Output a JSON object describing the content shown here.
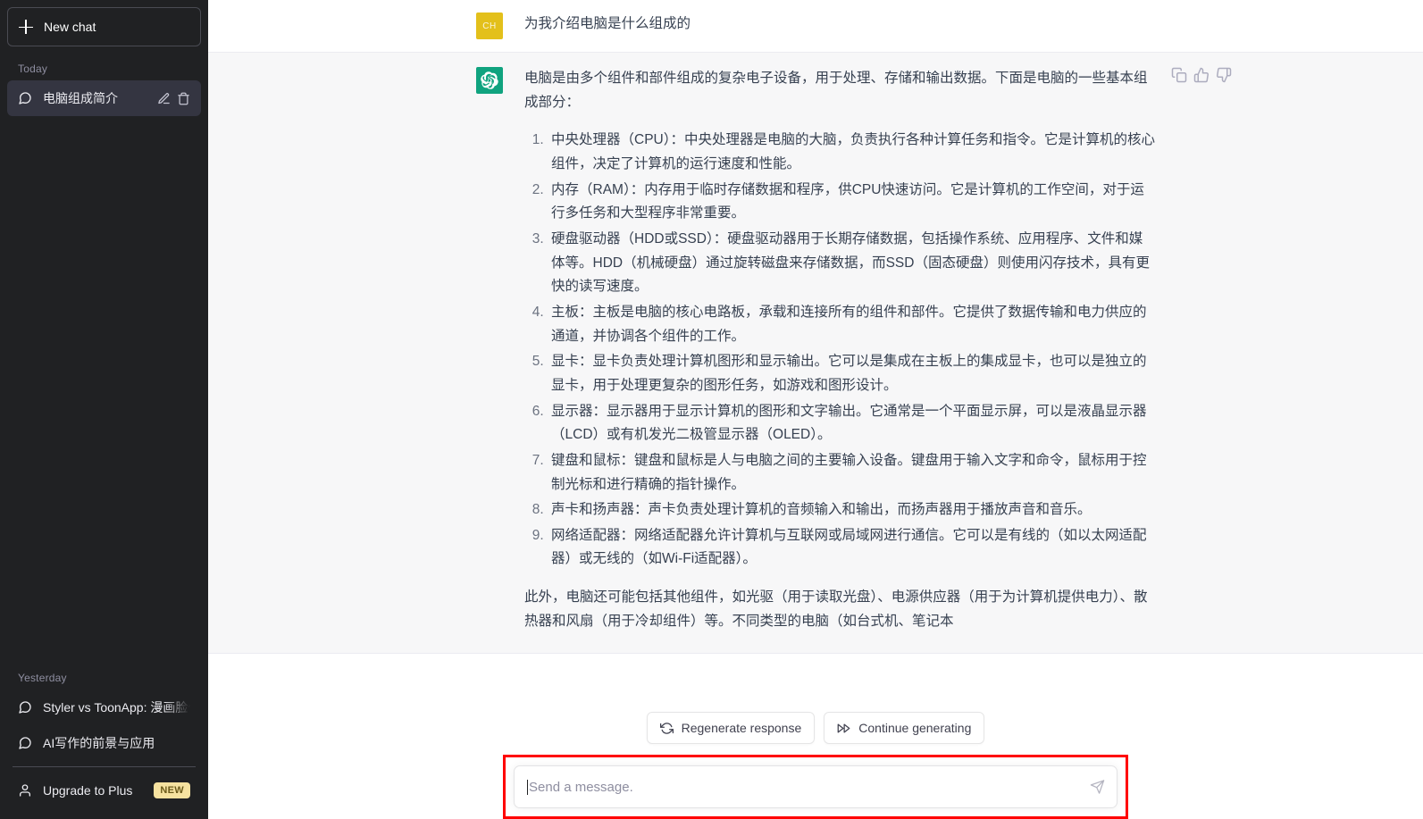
{
  "sidebar": {
    "new_chat_label": "New chat",
    "groups": [
      {
        "label": "Today",
        "items": [
          {
            "title": "电脑组成简介",
            "active": true
          }
        ]
      },
      {
        "label": "Yesterday",
        "items": [
          {
            "title": "Styler vs ToonApp: 漫画脸优势",
            "active": false
          },
          {
            "title": "AI写作的前景与应用",
            "active": false
          }
        ]
      }
    ],
    "upgrade": {
      "label": "Upgrade to Plus",
      "badge": "NEW"
    },
    "icons": {
      "new_chat": "plus-icon",
      "chat": "message-bubble-icon",
      "edit": "pencil-icon",
      "delete": "trash-icon",
      "user": "person-icon"
    }
  },
  "conversation": {
    "user_message": {
      "avatar_initials": "CH",
      "text": "为我介绍电脑是什么组成的"
    },
    "assistant_message": {
      "avatar": "chatgpt-logo",
      "intro": "电脑是由多个组件和部件组成的复杂电子设备，用于处理、存储和输出数据。下面是电脑的一些基本组成部分：",
      "list": [
        "中央处理器（CPU）：中央处理器是电脑的大脑，负责执行各种计算任务和指令。它是计算机的核心组件，决定了计算机的运行速度和性能。",
        "内存（RAM）：内存用于临时存储数据和程序，供CPU快速访问。它是计算机的工作空间，对于运行多任务和大型程序非常重要。",
        "硬盘驱动器（HDD或SSD）：硬盘驱动器用于长期存储数据，包括操作系统、应用程序、文件和媒体等。HDD（机械硬盘）通过旋转磁盘来存储数据，而SSD（固态硬盘）则使用闪存技术，具有更快的读写速度。",
        "主板：主板是电脑的核心电路板，承载和连接所有的组件和部件。它提供了数据传输和电力供应的通道，并协调各个组件的工作。",
        "显卡：显卡负责处理计算机图形和显示输出。它可以是集成在主板上的集成显卡，也可以是独立的显卡，用于处理更复杂的图形任务，如游戏和图形设计。",
        "显示器：显示器用于显示计算机的图形和文字输出。它通常是一个平面显示屏，可以是液晶显示器（LCD）或有机发光二极管显示器（OLED）。",
        "键盘和鼠标：键盘和鼠标是人与电脑之间的主要输入设备。键盘用于输入文字和命令，鼠标用于控制光标和进行精确的指针操作。",
        "声卡和扬声器：声卡负责处理计算机的音频输入和输出，而扬声器用于播放声音和音乐。",
        "网络适配器：网络适配器允许计算机与互联网或局域网进行通信。它可以是有线的（如以太网适配器）或无线的（如Wi-Fi适配器）。"
      ],
      "outro": "此外，电脑还可能包括其他组件，如光驱（用于读取光盘）、电源供应器（用于为计算机提供电力）、散热器和风扇（用于冷却组件）等。不同类型的电脑（如台式机、笔记本",
      "actions": {
        "copy": "copy-icon",
        "thumbs_up": "thumbs-up-icon",
        "thumbs_down": "thumbs-down-icon"
      }
    }
  },
  "bottom": {
    "regenerate_label": "Regenerate response",
    "continue_label": "Continue generating",
    "regenerate_icon": "refresh-icon",
    "continue_icon": "fast-forward-icon",
    "composer_placeholder": "Send a message.",
    "send_icon": "send-paper-plane-icon"
  },
  "colors": {
    "sidebar_bg": "#202123",
    "active_item_bg": "#343541",
    "assistant_bg": "#f7f7f8",
    "brand_green": "#10a37f",
    "user_avatar": "#e3c01b",
    "highlight_red": "#ff0000",
    "badge_yellow": "#f6e2a0"
  }
}
